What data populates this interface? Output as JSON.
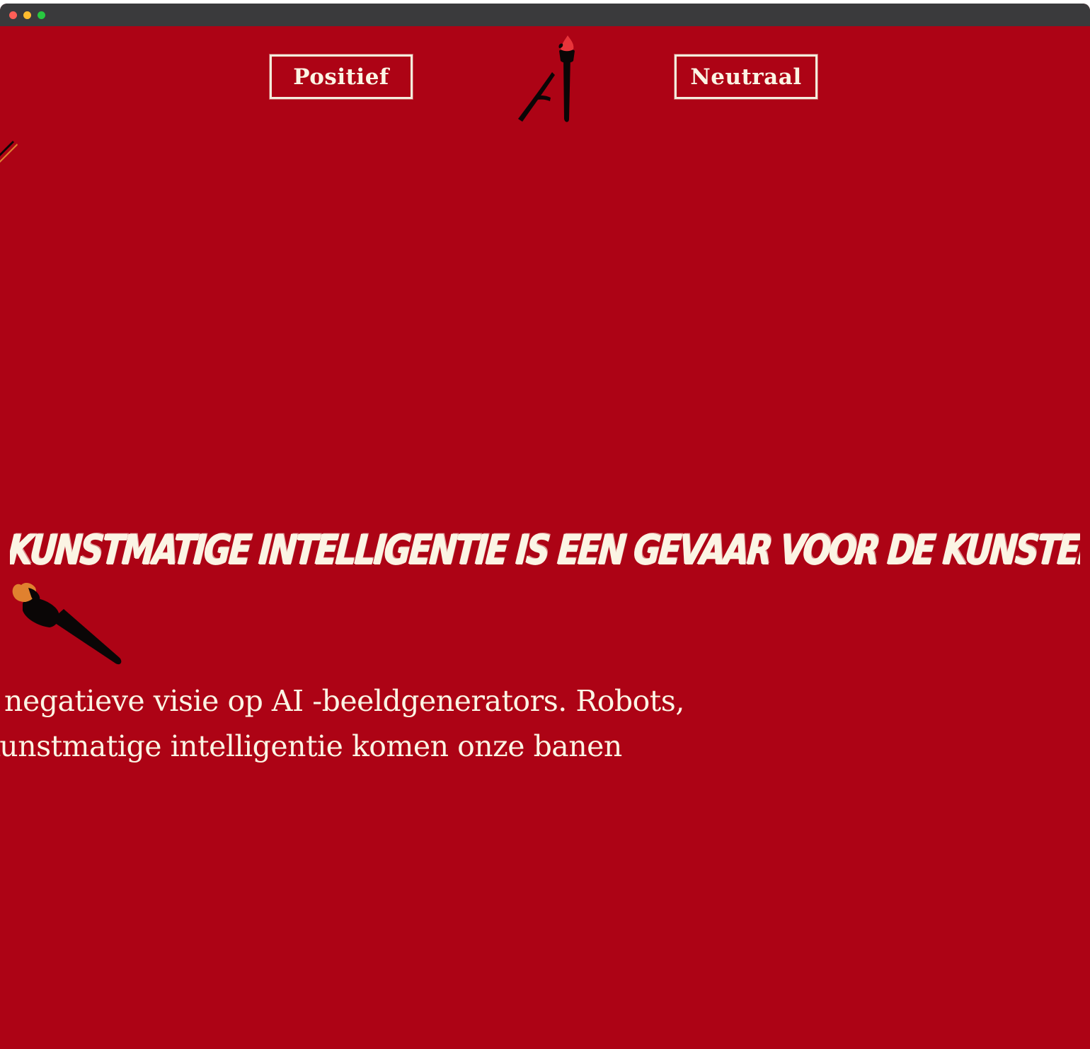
{
  "browser": {
    "controls": [
      "close",
      "minimize",
      "maximize"
    ]
  },
  "nav": {
    "left_label": "Positief",
    "right_label": "Neutraal"
  },
  "logo": {
    "icon": "ai-paintbrush-logo-icon"
  },
  "hero": {
    "headline": "KUNSTMATIGE INTELLIGENTIE IS EEN GEVAAR VOOR DE KUNSTENAAR",
    "body_line_1": "m bij de negatieve visie op AI -beeldgenerators. Robots,",
    "body_line_2": "nes en kunstmatige intelligentie komen onze banen"
  },
  "colors": {
    "background": "#ad0315",
    "text": "#fbf4e4",
    "brush_black": "#0a0606",
    "brush_tip_red": "#e8343a",
    "brush_tip_orange": "#e0812f",
    "titlebar": "#3a3a3c"
  }
}
